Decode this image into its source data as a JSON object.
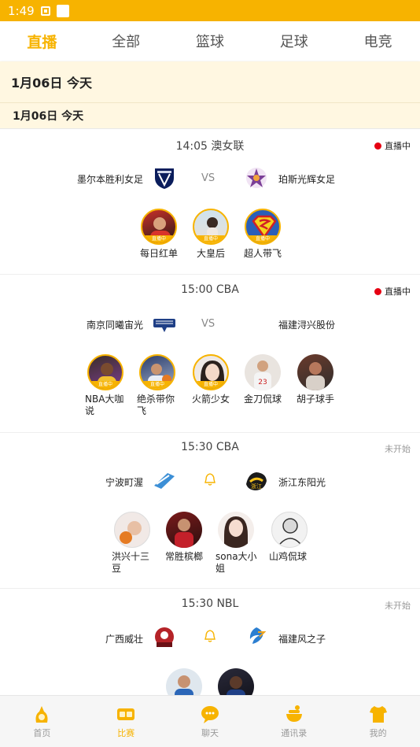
{
  "status_bar": {
    "time": "1:49"
  },
  "tabs": [
    {
      "label": "直播",
      "active": true
    },
    {
      "label": "全部",
      "active": false
    },
    {
      "label": "篮球",
      "active": false
    },
    {
      "label": "足球",
      "active": false
    },
    {
      "label": "电竞",
      "active": false
    }
  ],
  "date_banner": "1月06日  今天",
  "date_subheader": "1月06日    今天",
  "matches": [
    {
      "time_league": "14:05 澳女联",
      "status": "直播中",
      "home": "墨尔本胜利女足",
      "middle": "VS",
      "away": "珀斯光辉女足",
      "anchors": [
        {
          "name": "每日红单",
          "badge": "直播中"
        },
        {
          "name": "大皇后",
          "badge": "直播中"
        },
        {
          "name": "超人带飞",
          "badge": "直播中"
        }
      ]
    },
    {
      "time_league": "15:00 CBA",
      "status": "直播中",
      "home": "南京同曦宙光",
      "middle": "VS",
      "away": "福建浔兴股份",
      "anchors": [
        {
          "name": "NBA大咖说",
          "badge": "直播中"
        },
        {
          "name": "绝杀带你飞",
          "badge": "直播中"
        },
        {
          "name": "火箭少女",
          "badge": "直播中"
        },
        {
          "name": "金刀侃球",
          "badge": ""
        },
        {
          "name": "胡子球手",
          "badge": ""
        }
      ]
    },
    {
      "time_league": "15:30 CBA",
      "status": "未开始",
      "home": "宁波町渥",
      "middle": "",
      "away": "浙江东阳光",
      "anchors": [
        {
          "name": "洪兴十三豆",
          "badge": ""
        },
        {
          "name": "常胜槟榔",
          "badge": ""
        },
        {
          "name": "sona大小姐",
          "badge": ""
        },
        {
          "name": "山鸡侃球",
          "badge": ""
        }
      ]
    },
    {
      "time_league": "15:30 NBL",
      "status": "未开始",
      "home": "广西威壮",
      "middle": "",
      "away": "福建风之子",
      "anchors": []
    }
  ],
  "bottom_nav": [
    {
      "label": "首页",
      "active": false
    },
    {
      "label": "比赛",
      "active": true
    },
    {
      "label": "聊天",
      "active": false
    },
    {
      "label": "通讯录",
      "active": false
    },
    {
      "label": "我的",
      "active": false
    }
  ],
  "colors": {
    "accent": "#f7b300",
    "live": "#e60012",
    "banner_bg": "#fff7e1"
  }
}
